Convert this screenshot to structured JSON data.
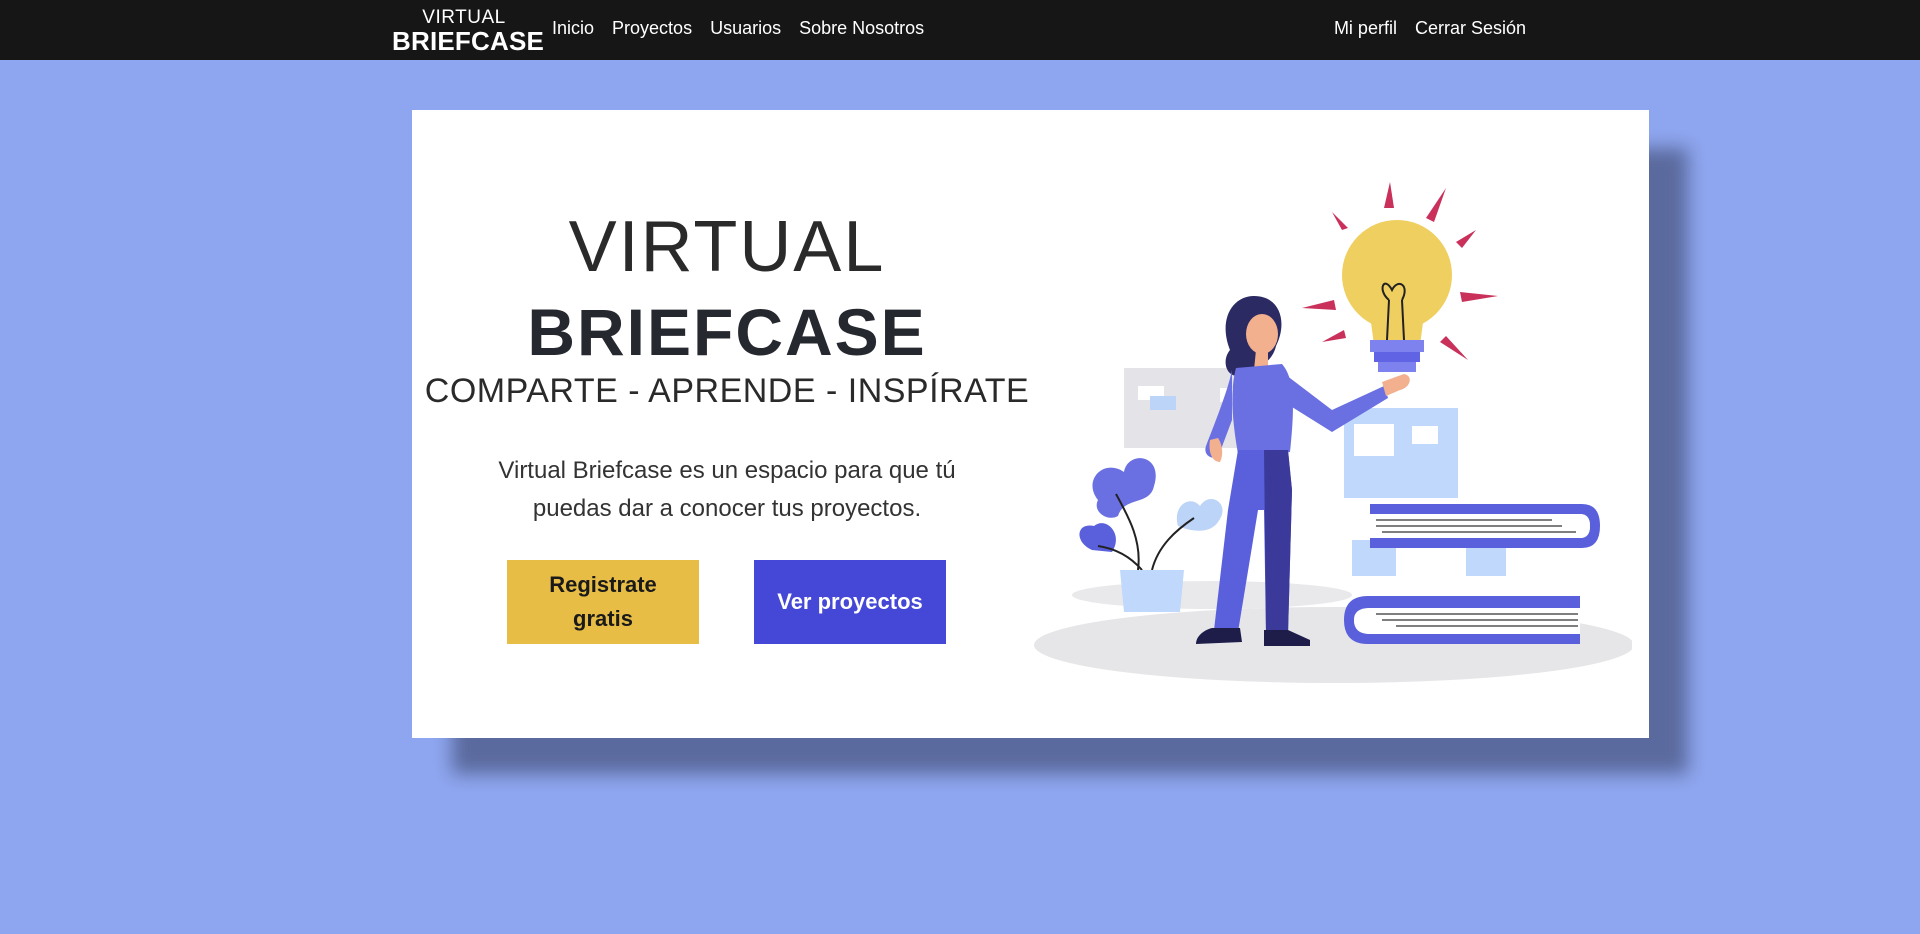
{
  "navbar": {
    "brand_top": "VIRTUAL",
    "brand_bottom": "BRIEFCASE",
    "links_left": [
      "Inicio",
      "Proyectos",
      "Usuarios",
      "Sobre Nosotros"
    ],
    "links_right": [
      "Mi perfil",
      "Cerrar Sesión"
    ]
  },
  "hero": {
    "title_line1": "VIRTUAL",
    "title_line2": "BRIEFCASE",
    "tagline": "COMPARTE - APRENDE - INSPÍRATE",
    "description": "Virtual Briefcase es un espacio para que tú puedas dar a conocer tus proyectos.",
    "register_button": "Registrate gratis",
    "projects_button": "Ver proyectos"
  },
  "colors": {
    "page_background": "#8ea6ef",
    "navbar": "#161616",
    "register_button": "#e8bd46",
    "projects_button": "#4548d6"
  },
  "illustration": {
    "icons": [
      "woman-figure-icon",
      "lightbulb-icon",
      "book-stack-icon",
      "plant-pot-icon",
      "board-icon"
    ]
  }
}
